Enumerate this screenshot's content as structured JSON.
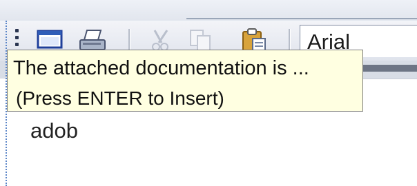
{
  "toolbar": {
    "buttons": [
      {
        "name": "new-window-icon",
        "enabled": true
      },
      {
        "name": "print-icon",
        "enabled": true
      },
      {
        "name": "cut-icon",
        "enabled": false
      },
      {
        "name": "copy-icon",
        "enabled": false
      },
      {
        "name": "paste-icon",
        "enabled": true
      }
    ],
    "font_name": "Arial"
  },
  "tooltip": {
    "title": "The attached documentation is ...",
    "hint": "(Press ENTER to Insert)"
  },
  "editor": {
    "text": "adob"
  },
  "colors": {
    "tooltip_bg": "#ffffe1",
    "toolbar_bg": "#e6e9f0",
    "accent_blue": "#2f5db8"
  }
}
